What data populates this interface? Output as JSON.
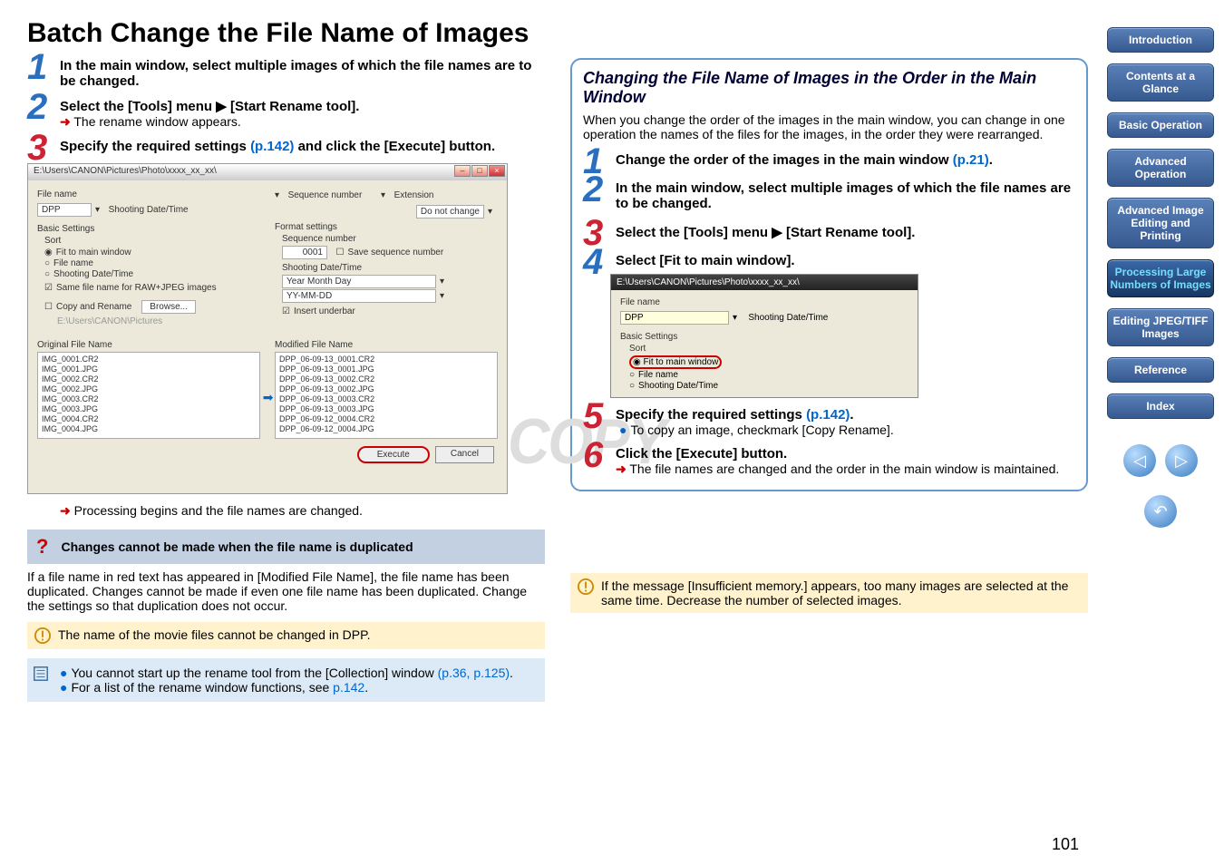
{
  "page_title": "Batch Change the File Name of Images",
  "page_num": "101",
  "watermark": "COPY",
  "left_steps": {
    "s1": "In the main window, select multiple images of which the file names are to be changed.",
    "s2": "Select the [Tools] menu ▶ [Start Rename tool].",
    "s2_note": "The rename window appears.",
    "s3a": "Specify the required settings ",
    "s3_link": "(p.142)",
    "s3b": " and click the [Execute] button."
  },
  "ss1": {
    "title": "E:\\Users\\CANON\\Pictures\\Photo\\xxxx_xx_xx\\",
    "file_name_label": "File name",
    "file_name_val": "DPP",
    "shooting": "Shooting Date/Time",
    "seq_label": "Sequence number",
    "ext_label": "Extension",
    "ext_val": "Do not change",
    "basic": "Basic Settings",
    "format": "Format settings",
    "sort": "Sort",
    "fit": "Fit to main window",
    "fn": "File name",
    "sdt": "Shooting Date/Time",
    "same": "Same file name for RAW+JPEG images",
    "copy": "Copy and Rename",
    "browse": "Browse...",
    "copypath": "E:\\Users\\CANON\\Pictures",
    "seqnum": "Sequence number",
    "seqval": "0001",
    "save_seq": "Save sequence number",
    "sdt2": "Shooting Date/Time",
    "ymd": "Year Month Day",
    "yymmdd": "YY-MM-DD",
    "underbar": "Insert underbar",
    "orig_label": "Original File Name",
    "mod_label": "Modified File Name",
    "orig": [
      "IMG_0001.CR2",
      "IMG_0001.JPG",
      "IMG_0002.CR2",
      "IMG_0002.JPG",
      "IMG_0003.CR2",
      "IMG_0003.JPG",
      "IMG_0004.CR2",
      "IMG_0004.JPG"
    ],
    "mod": [
      "DPP_06-09-13_0001.CR2",
      "DPP_06-09-13_0001.JPG",
      "DPP_06-09-13_0002.CR2",
      "DPP_06-09-13_0002.JPG",
      "DPP_06-09-13_0003.CR2",
      "DPP_06-09-13_0003.JPG",
      "DPP_06-09-12_0004.CR2",
      "DPP_06-09-12_0004.JPG"
    ],
    "execute": "Execute",
    "cancel": "Cancel"
  },
  "processing_note": "Processing begins and the file names are changed.",
  "help_title": "Changes cannot be made when the file name is duplicated",
  "help_body": "If a file name in red text has appeared in [Modified File Name], the file name has been duplicated. Changes cannot be made if even one file name has been duplicated. Change the settings so that duplication does not occur.",
  "warn1": "The name of the movie files cannot be changed in DPP.",
  "tip1a": "You cannot start up the rename tool from the [Collection] window ",
  "tip1_link": "(p.36, p.125)",
  "tip1b": ".",
  "tip2a": "For a list of the rename window functions, see ",
  "tip2_link": "p.142",
  "tip2b": ".",
  "right_box": {
    "title": "Changing the File Name of Images in the Order in the Main Window",
    "intro": "When you change the order of the images in the main window, you can change in one operation the names of the files for the images, in the order they were rearranged.",
    "s1a": "Change the order of the images in the main window ",
    "s1_link": "(p.21)",
    "s1b": ".",
    "s2": "In the main window, select multiple images of which the file names are to be changed.",
    "s3": "Select the [Tools] menu ▶ [Start Rename tool].",
    "s4": "Select [Fit to main window].",
    "s5a": "Specify the required settings ",
    "s5_link": "(p.142)",
    "s5b": ".",
    "s5_note": "To copy an image, checkmark [Copy Rename].",
    "s6": "Click the [Execute] button.",
    "s6_note": "The file names are changed and the order in the main window is maintained."
  },
  "ss2": {
    "title": "E:\\Users\\CANON\\Pictures\\Photo\\xxxx_xx_xx\\",
    "fn_label": "File name",
    "fn_val": "DPP",
    "sdt": "Shooting Date/Time",
    "basic": "Basic Settings",
    "sort": "Sort",
    "fit": "Fit to main window",
    "fn": "File name",
    "sdt2": "Shooting Date/Time"
  },
  "warn2": "If the message [Insufficient memory.] appears, too many images are selected at the same time. Decrease the number of selected images.",
  "nav": {
    "intro": "Introduction",
    "contents": "Contents at a Glance",
    "basic": "Basic Operation",
    "adv": "Advanced Operation",
    "adv2": "Advanced Image Editing and Printing",
    "proc": "Processing Large Numbers of Images",
    "edit": "Editing JPEG/TIFF Images",
    "ref": "Reference",
    "idx": "Index"
  }
}
